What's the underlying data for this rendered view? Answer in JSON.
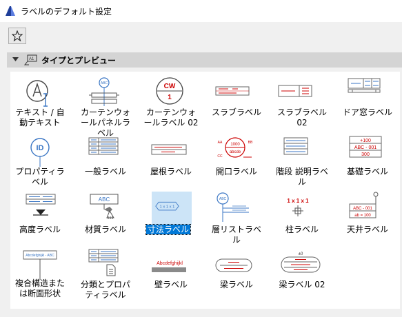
{
  "window": {
    "title": "ラベルのデフォルト設定"
  },
  "panel": {
    "title": "タイプとプレビュー"
  },
  "icon_texts": {
    "abc": "ABC",
    "cw": "CW",
    "one": "1",
    "id": "ID",
    "dim": "1 x 1 x 1",
    "col": "1 x 1 x 1",
    "abcdef": "Abcdefghijkl",
    "composite": "Abcdefghijkl - ABC",
    "p100": "+100",
    "abc001": "ABC - 001",
    "v300": "300",
    "abcde": "abcde",
    "v1000": "1000",
    "aa": "AA",
    "bb": "BB",
    "cc": "CC",
    "ab100": "ab = 100",
    "pm0": "±0"
  },
  "items": [
    {
      "key": "text",
      "label": "テキスト / 自動テキスト"
    },
    {
      "key": "cwpanel",
      "label": "カーテンウォールパネルラベル"
    },
    {
      "key": "cw02",
      "label": "カーテンウォールラベル 02"
    },
    {
      "key": "slab",
      "label": "スラブラベル"
    },
    {
      "key": "slab02",
      "label": "スラブラベル 02"
    },
    {
      "key": "doorwin",
      "label": "ドア窓ラベル"
    },
    {
      "key": "property",
      "label": "プロパティラベル"
    },
    {
      "key": "general",
      "label": "一般ラベル"
    },
    {
      "key": "roof",
      "label": "屋根ラベル"
    },
    {
      "key": "opening",
      "label": "開口ラベル"
    },
    {
      "key": "stair",
      "label": "階段 説明ラベル"
    },
    {
      "key": "foundation",
      "label": "基礎ラベル"
    },
    {
      "key": "elevation",
      "label": "高度ラベル"
    },
    {
      "key": "material",
      "label": "材質ラベル"
    },
    {
      "key": "dimension",
      "label": "寸法ラベル"
    },
    {
      "key": "layerlist",
      "label": "層リストラベル"
    },
    {
      "key": "column",
      "label": "柱ラベル"
    },
    {
      "key": "ceiling",
      "label": "天井ラベル"
    },
    {
      "key": "composite",
      "label": "複合構造または断面形状"
    },
    {
      "key": "classprop",
      "label": "分類とプロパティラベル"
    },
    {
      "key": "wall",
      "label": "壁ラベル"
    },
    {
      "key": "beam",
      "label": "梁ラベル"
    },
    {
      "key": "beam02",
      "label": "梁ラベル 02"
    }
  ],
  "selected_item": "寸法ラベル"
}
